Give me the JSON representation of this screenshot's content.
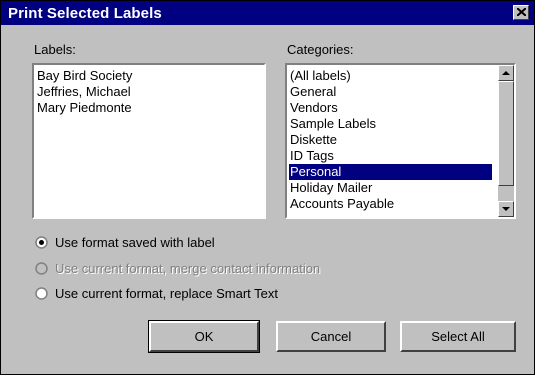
{
  "window": {
    "title": "Print Selected Labels"
  },
  "labels": {
    "heading": "Labels:",
    "items": [
      "Bay Bird Society",
      "Jeffries, Michael",
      "Mary Piedmonte"
    ]
  },
  "categories": {
    "heading": "Categories:",
    "items": [
      "(All labels)",
      "General",
      "Vendors",
      "Sample Labels",
      "Diskette",
      "ID Tags",
      "Personal",
      "Holiday Mailer",
      "Accounts Payable"
    ],
    "selected": "Personal"
  },
  "options": [
    {
      "label": "Use format saved with label",
      "checked": true,
      "enabled": true
    },
    {
      "label": "Use current format, merge contact information",
      "checked": false,
      "enabled": false
    },
    {
      "label": "Use current format, replace Smart Text",
      "checked": false,
      "enabled": true
    }
  ],
  "buttons": {
    "ok": "OK",
    "cancel": "Cancel",
    "select_all": "Select All"
  },
  "colors": {
    "face": "#c0c0c0",
    "titlebar": "#000080",
    "selection": "#000080"
  }
}
